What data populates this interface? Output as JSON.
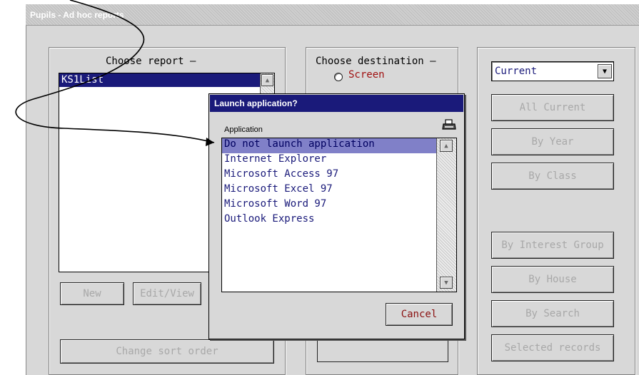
{
  "window": {
    "title": "Pupils - Ad hoc reports"
  },
  "report_panel": {
    "heading": "Choose report –",
    "reports": [
      "KS1List"
    ],
    "new_label": "New",
    "edit_label": "Edit/View",
    "sort_label": "Change sort order"
  },
  "destination_panel": {
    "heading": "Choose destination –",
    "options": [
      "Screen"
    ]
  },
  "filter_panel": {
    "select_value": "Current",
    "buttons": [
      "All Current",
      "By Year",
      "By Class",
      "By Interest Group",
      "By House",
      "By Search",
      "Selected records"
    ]
  },
  "dialog": {
    "title": "Launch application?",
    "column_header": "Application",
    "items": [
      "Do not launch application",
      "Internet Explorer",
      "Microsoft Access 97",
      "Microsoft Excel 97",
      "Microsoft Word 97",
      "Outlook Express"
    ],
    "selected_index": 0,
    "cancel_label": "Cancel"
  },
  "colors": {
    "accent": "#1a1a7a",
    "radio_text": "#a01010",
    "disabled_text": "#a8a8a8"
  },
  "icons": [
    "printer-icon",
    "scroll-up-icon",
    "scroll-down-icon",
    "dropdown-arrow-icon",
    "radio-icon"
  ]
}
